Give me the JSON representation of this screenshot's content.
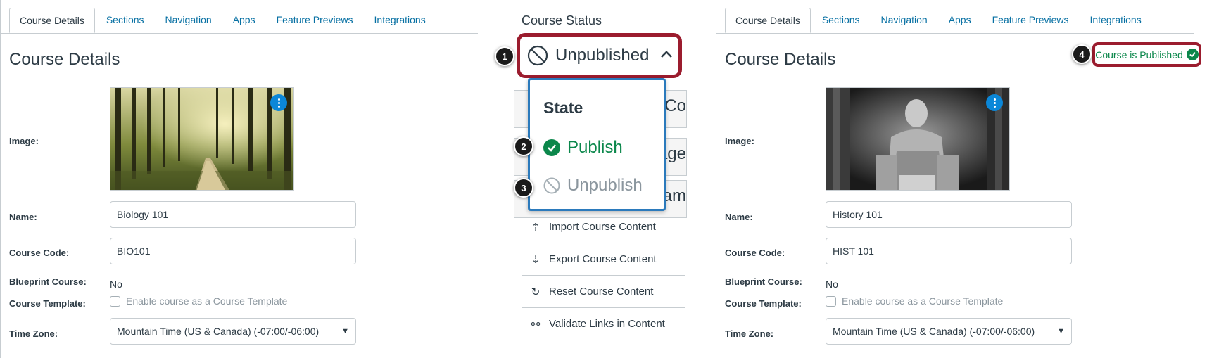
{
  "left": {
    "tabs": [
      "Course Details",
      "Sections",
      "Navigation",
      "Apps",
      "Feature Previews",
      "Integrations"
    ],
    "title": "Course Details",
    "image_label": "Image:",
    "name_label": "Name:",
    "name_value": "Biology 101",
    "code_label": "Course Code:",
    "code_value": "BIO101",
    "blueprint_label": "Blueprint Course:",
    "blueprint_value": "No",
    "template_label": "Course Template:",
    "template_checkbox": "Enable course as a Course Template",
    "timezone_label": "Time Zone:",
    "timezone_value": "Mountain Time (US & Canada) (-07:00/-06:00)"
  },
  "middle": {
    "heading": "Course Status",
    "status_button": "Unpublished",
    "dropdown_heading": "State",
    "publish": "Publish",
    "unpublish": "Unpublish",
    "bg_fragments": [
      "Co",
      "Page",
      "ream"
    ],
    "links": [
      "Import Course Content",
      "Export Course Content",
      "Reset Course Content",
      "Validate Links in Content"
    ]
  },
  "right": {
    "tabs": [
      "Course Details",
      "Sections",
      "Navigation",
      "Apps",
      "Feature Previews",
      "Integrations"
    ],
    "title": "Course Details",
    "published_status": "Course is Published",
    "image_label": "Image:",
    "name_label": "Name:",
    "name_value": "History 101",
    "code_label": "Course Code:",
    "code_value": "HIST 101",
    "blueprint_label": "Blueprint Course:",
    "blueprint_value": "No",
    "template_label": "Course Template:",
    "template_checkbox": "Enable course as a Course Template",
    "timezone_label": "Time Zone:",
    "timezone_value": "Mountain Time (US & Canada) (-07:00/-06:00)"
  },
  "badges": [
    "1",
    "2",
    "3",
    "4"
  ],
  "colors": {
    "link": "#0770a3",
    "success": "#0b874b",
    "highlight": "#9b1c2e",
    "dropdown_border": "#2b7abc",
    "kebab": "#0b87d8"
  },
  "icons": [
    "unpublished-icon",
    "caret-up-icon",
    "check-circle-icon",
    "upload-icon",
    "download-icon",
    "reset-icon",
    "link-icon",
    "kebab-icon",
    "chevron-down-icon"
  ]
}
